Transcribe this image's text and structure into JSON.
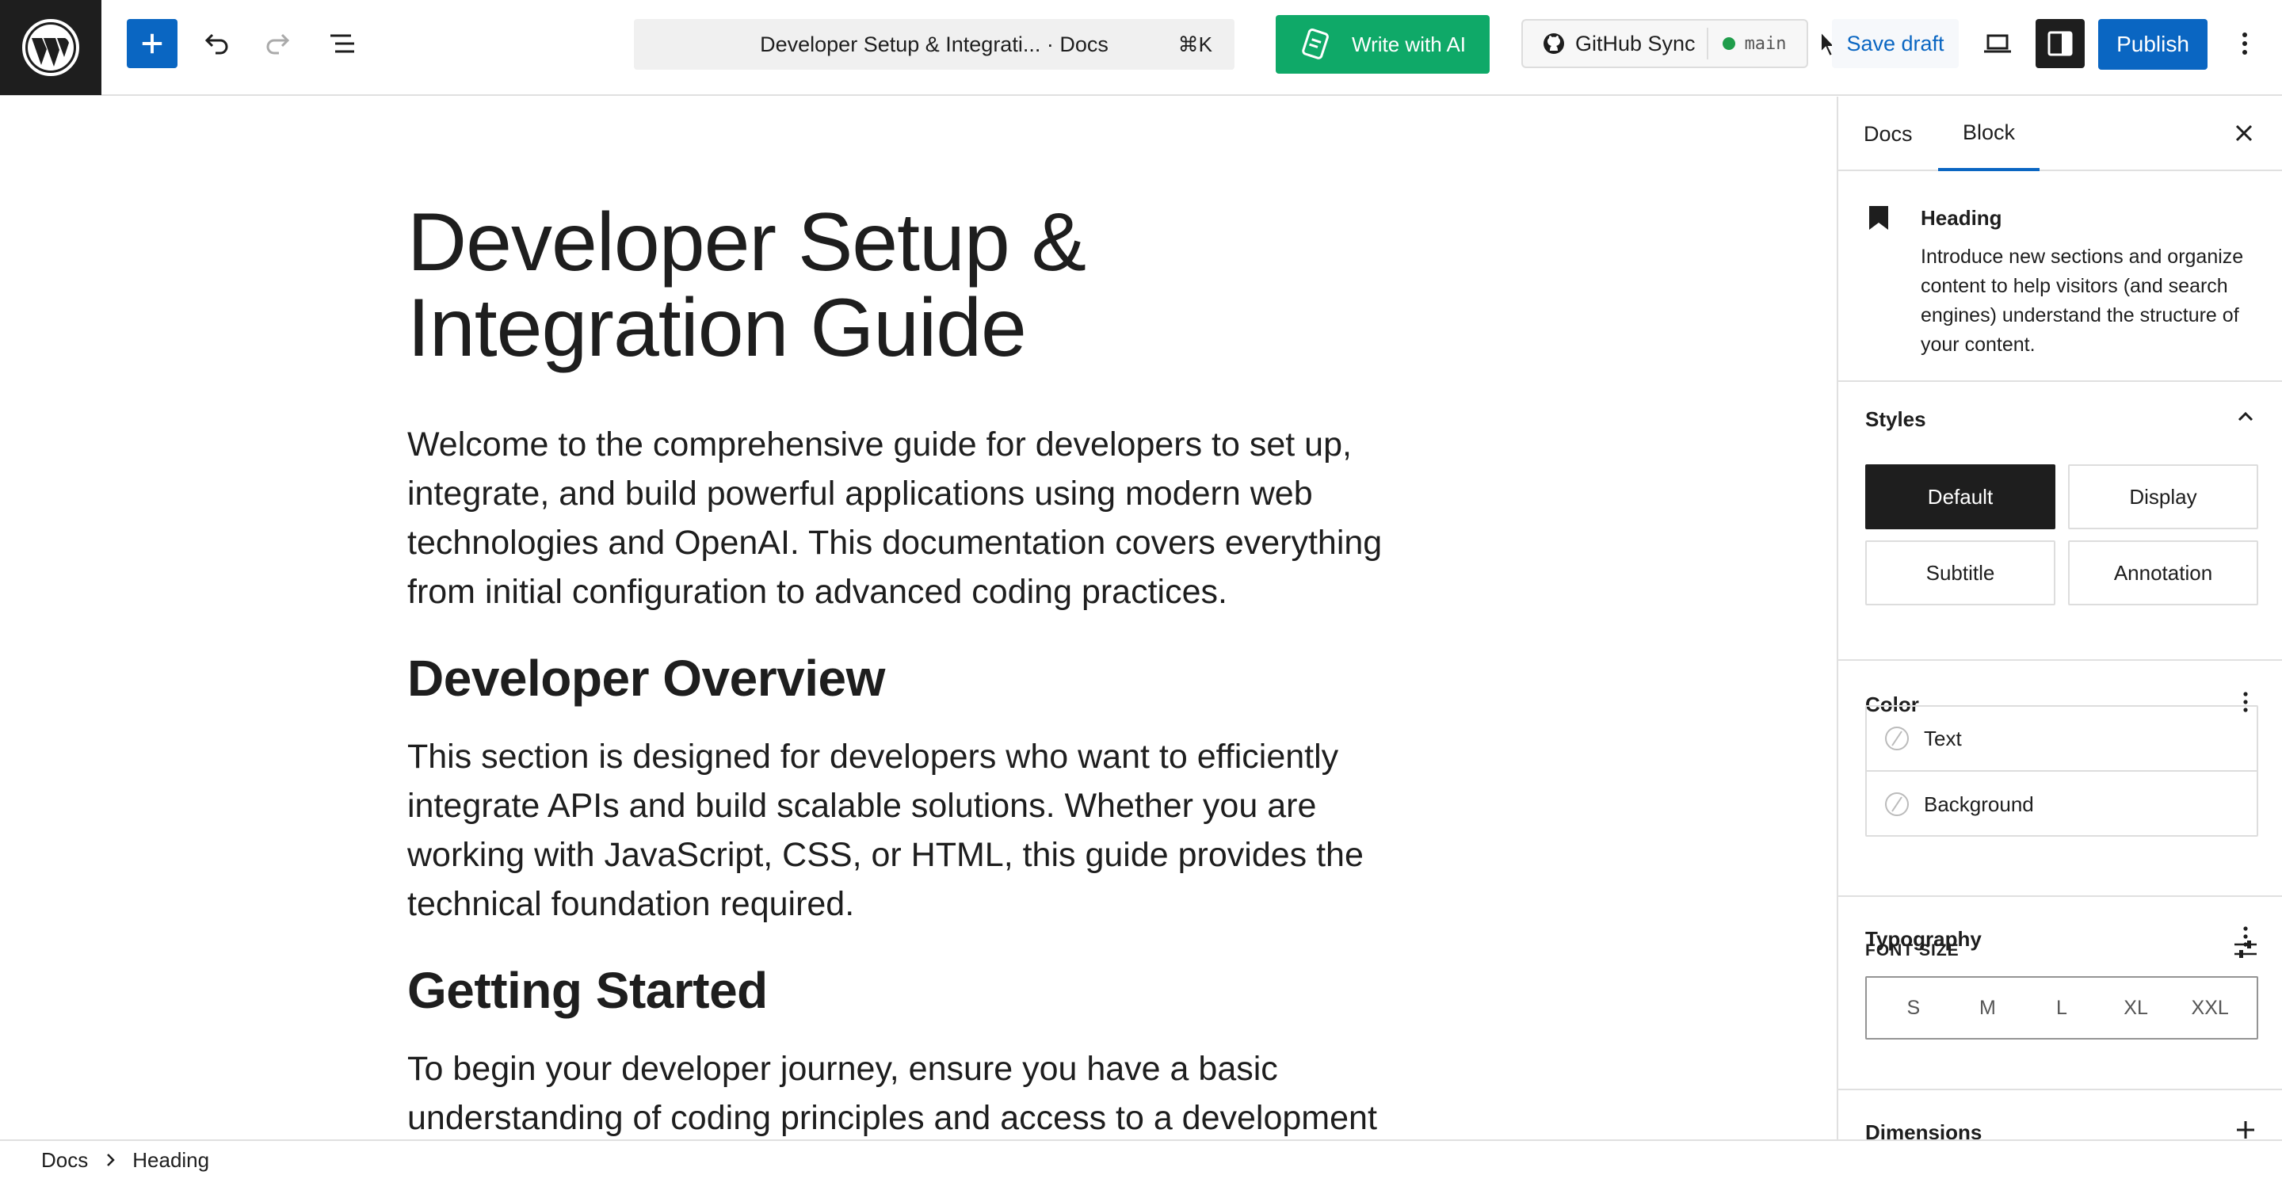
{
  "toolbar": {
    "doc_title": "Developer Setup & Integrati...",
    "doc_type": "· Docs",
    "shortcut": "⌘K",
    "write_ai_label": "Write with AI",
    "github_label": "GitHub Sync",
    "branch": "main",
    "save_draft_label": "Save draft",
    "publish_label": "Publish"
  },
  "editor": {
    "title": "Developer Setup & Integration Guide",
    "intro": "Welcome to the comprehensive guide for developers to set up, integrate, and build powerful applications using modern web technologies and OpenAI. This documentation covers everything from initial configuration to advanced coding practices.",
    "h_overview": "Developer Overview",
    "overview_text": "This section is designed for developers who want to efficiently integrate APIs and build scalable solutions. Whether you are working with JavaScript, CSS, or HTML, this guide provides the technical foundation required.",
    "h_started": "Getting Started",
    "started_text": "To begin your developer journey, ensure you have a basic understanding of coding principles and access to a development"
  },
  "sidebar": {
    "tabs": [
      "Docs",
      "Block"
    ],
    "active_tab": "Block",
    "block": {
      "name": "Heading",
      "description": "Introduce new sections and organize content to help visitors (and search engines) understand the structure of your content."
    },
    "styles": {
      "title": "Styles",
      "options": [
        "Default",
        "Display",
        "Subtitle",
        "Annotation"
      ],
      "selected": "Default"
    },
    "color": {
      "title": "Color",
      "items": [
        "Text",
        "Background"
      ]
    },
    "typography": {
      "title": "Typography",
      "font_size_label": "FONT SIZE",
      "sizes": [
        "S",
        "M",
        "L",
        "XL",
        "XXL"
      ]
    },
    "dimensions": {
      "title": "Dimensions"
    }
  },
  "breadcrumb": {
    "items": [
      "Docs",
      "Heading"
    ]
  },
  "colors": {
    "primary": "#0a66c2",
    "ai_green": "#0fa968",
    "dark": "#1e1e1e",
    "border": "#e0e0e0",
    "branch_dot": "#1f9d4b"
  }
}
